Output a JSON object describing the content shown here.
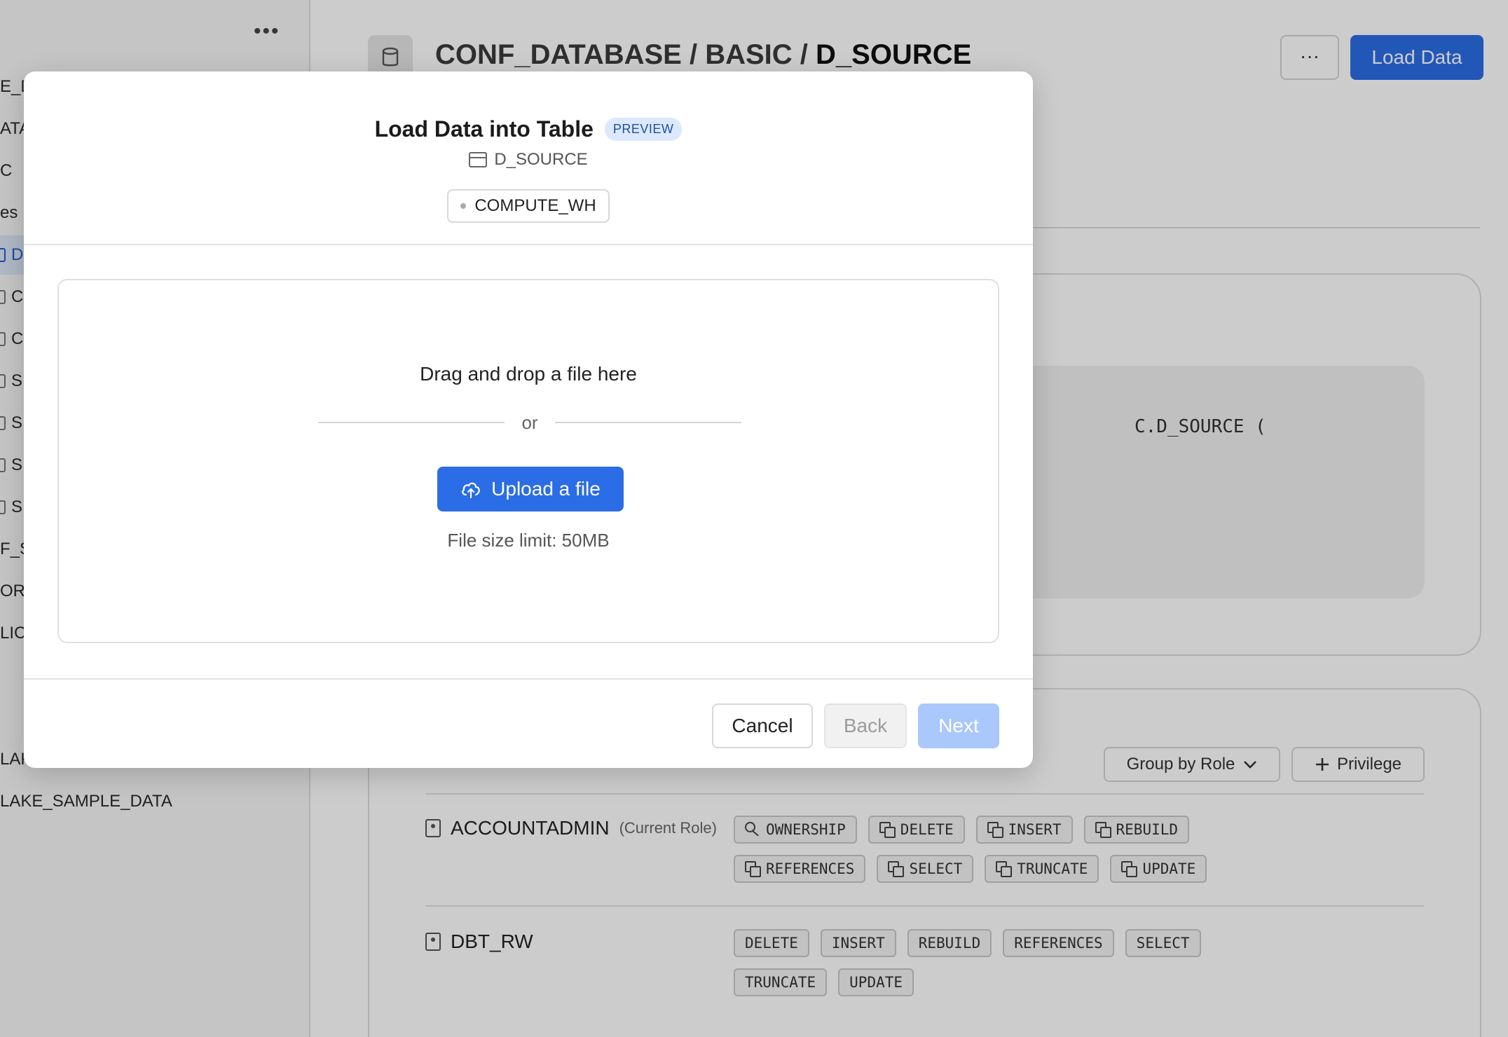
{
  "colors": {
    "accent": "#2b6de6",
    "accent_disabled": "#aac8fb",
    "preview_badge_bg": "#dce8fd",
    "selected_item_bg": "#dde7f8",
    "overlay": "rgba(0,0,0,0.2)"
  },
  "sidebar": {
    "more_icon": "ellipsis-icon",
    "items": [
      {
        "label": "E_D"
      },
      {
        "label": "ATA"
      },
      {
        "label": "C"
      },
      {
        "label": "es"
      },
      {
        "label": "D",
        "selected": true
      },
      {
        "label": "C"
      },
      {
        "label": "C"
      },
      {
        "label": "S"
      },
      {
        "label": "S"
      },
      {
        "label": "S"
      },
      {
        "label": "S"
      },
      {
        "label": "F_S"
      },
      {
        "label": "ORM"
      },
      {
        "label": "LIC"
      },
      {
        "label": "LAK"
      },
      {
        "label": "LAKE_SAMPLE_DATA"
      }
    ]
  },
  "header": {
    "breadcrumb_prefix": "CONF_DATABASE / BASIC / ",
    "breadcrumb_last": "D_SOURCE",
    "more_label": "···",
    "load_data_label": "Load Data"
  },
  "code": {
    "visible_line": "C.D_SOURCE ("
  },
  "privileges": {
    "group_by_label": "Group by Role",
    "add_privilege_label": "Privilege",
    "roles": [
      {
        "name": "ACCOUNTADMIN",
        "note": "(Current Role)",
        "tags": [
          "OWNERSHIP",
          "DELETE",
          "INSERT",
          "REBUILD",
          "REFERENCES",
          "SELECT",
          "TRUNCATE",
          "UPDATE"
        ]
      },
      {
        "name": "DBT_RW",
        "note": "",
        "tags": [
          "DELETE",
          "INSERT",
          "REBUILD",
          "REFERENCES",
          "SELECT",
          "TRUNCATE",
          "UPDATE"
        ]
      }
    ]
  },
  "modal": {
    "title": "Load Data into Table",
    "badge": "PREVIEW",
    "table_name": "D_SOURCE",
    "warehouse": "COMPUTE_WH",
    "drop_text": "Drag and drop a file here",
    "or_text": "or",
    "upload_label": "Upload a file",
    "limit_text": "File size limit: 50MB",
    "cancel_label": "Cancel",
    "back_label": "Back",
    "next_label": "Next"
  }
}
